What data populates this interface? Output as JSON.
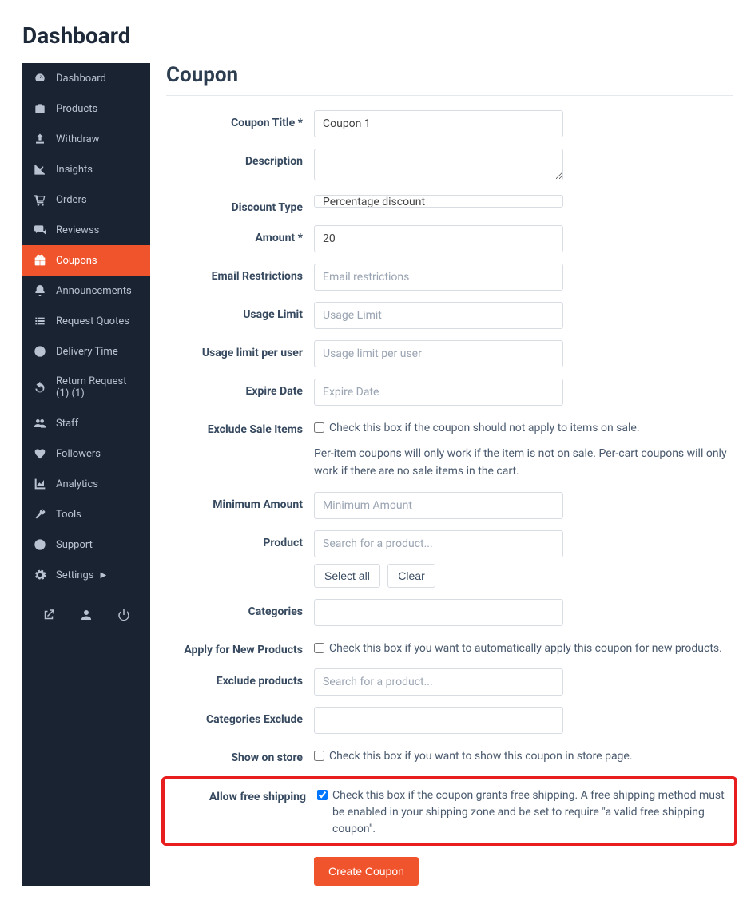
{
  "page_title": "Dashboard",
  "section_title": "Coupon",
  "sidebar": {
    "items": [
      {
        "label": "Dashboard",
        "icon": "gauge",
        "active": false
      },
      {
        "label": "Products",
        "icon": "briefcase",
        "active": false
      },
      {
        "label": "Withdraw",
        "icon": "upload",
        "active": false
      },
      {
        "label": "Insights",
        "icon": "linechart",
        "active": false
      },
      {
        "label": "Orders",
        "icon": "cart",
        "active": false
      },
      {
        "label": "Reviewss",
        "icon": "comments",
        "active": false
      },
      {
        "label": "Coupons",
        "icon": "gift",
        "active": true
      },
      {
        "label": "Announcements",
        "icon": "bell",
        "active": false
      },
      {
        "label": "Request Quotes",
        "icon": "list",
        "active": false
      },
      {
        "label": "Delivery Time",
        "icon": "clock",
        "active": false
      },
      {
        "label": "Return Request (1) (1)",
        "icon": "undo",
        "active": false
      },
      {
        "label": "Staff",
        "icon": "users",
        "active": false
      },
      {
        "label": "Followers",
        "icon": "heart",
        "active": false
      },
      {
        "label": "Analytics",
        "icon": "areachart",
        "active": false
      },
      {
        "label": "Tools",
        "icon": "wrench",
        "active": false
      },
      {
        "label": "Support",
        "icon": "lifering",
        "active": false
      },
      {
        "label": "Settings",
        "icon": "gear",
        "active": false,
        "chevron": true
      }
    ]
  },
  "form": {
    "coupon_title_label": "Coupon Title *",
    "coupon_title_value": "Coupon 1",
    "description_label": "Description",
    "description_value": "",
    "discount_type_label": "Discount Type",
    "discount_type_value": "Percentage discount",
    "amount_label": "Amount *",
    "amount_value": "20",
    "email_restrictions_label": "Email Restrictions",
    "email_restrictions_placeholder": "Email restrictions",
    "usage_limit_label": "Usage Limit",
    "usage_limit_placeholder": "Usage Limit",
    "usage_limit_per_user_label": "Usage limit per user",
    "usage_limit_per_user_placeholder": "Usage limit per user",
    "expire_date_label": "Expire Date",
    "expire_date_placeholder": "Expire Date",
    "exclude_sale_label": "Exclude Sale Items",
    "exclude_sale_check_text": "Check this box if the coupon should not apply to items on sale.",
    "exclude_sale_help": "Per-item coupons will only work if the item is not on sale. Per-cart coupons will only work if there are no sale items in the cart.",
    "minimum_amount_label": "Minimum Amount",
    "minimum_amount_placeholder": "Minimum Amount",
    "product_label": "Product",
    "product_placeholder": "Search for a product...",
    "select_all_label": "Select all",
    "clear_label": "Clear",
    "categories_label": "Categories",
    "apply_new_label": "Apply for New Products",
    "apply_new_check_text": "Check this box if you want to automatically apply this coupon for new products.",
    "exclude_products_label": "Exclude products",
    "exclude_products_placeholder": "Search for a product...",
    "categories_exclude_label": "Categories Exclude",
    "show_on_store_label": "Show on store",
    "show_on_store_check_text": "Check this box if you want to show this coupon in store page.",
    "allow_free_shipping_label": "Allow free shipping",
    "allow_free_shipping_check_text": "Check this box if the coupon grants free shipping. A free shipping method must be enabled in your shipping zone and be set to require \"a valid free shipping coupon\".",
    "submit_label": "Create Coupon"
  }
}
